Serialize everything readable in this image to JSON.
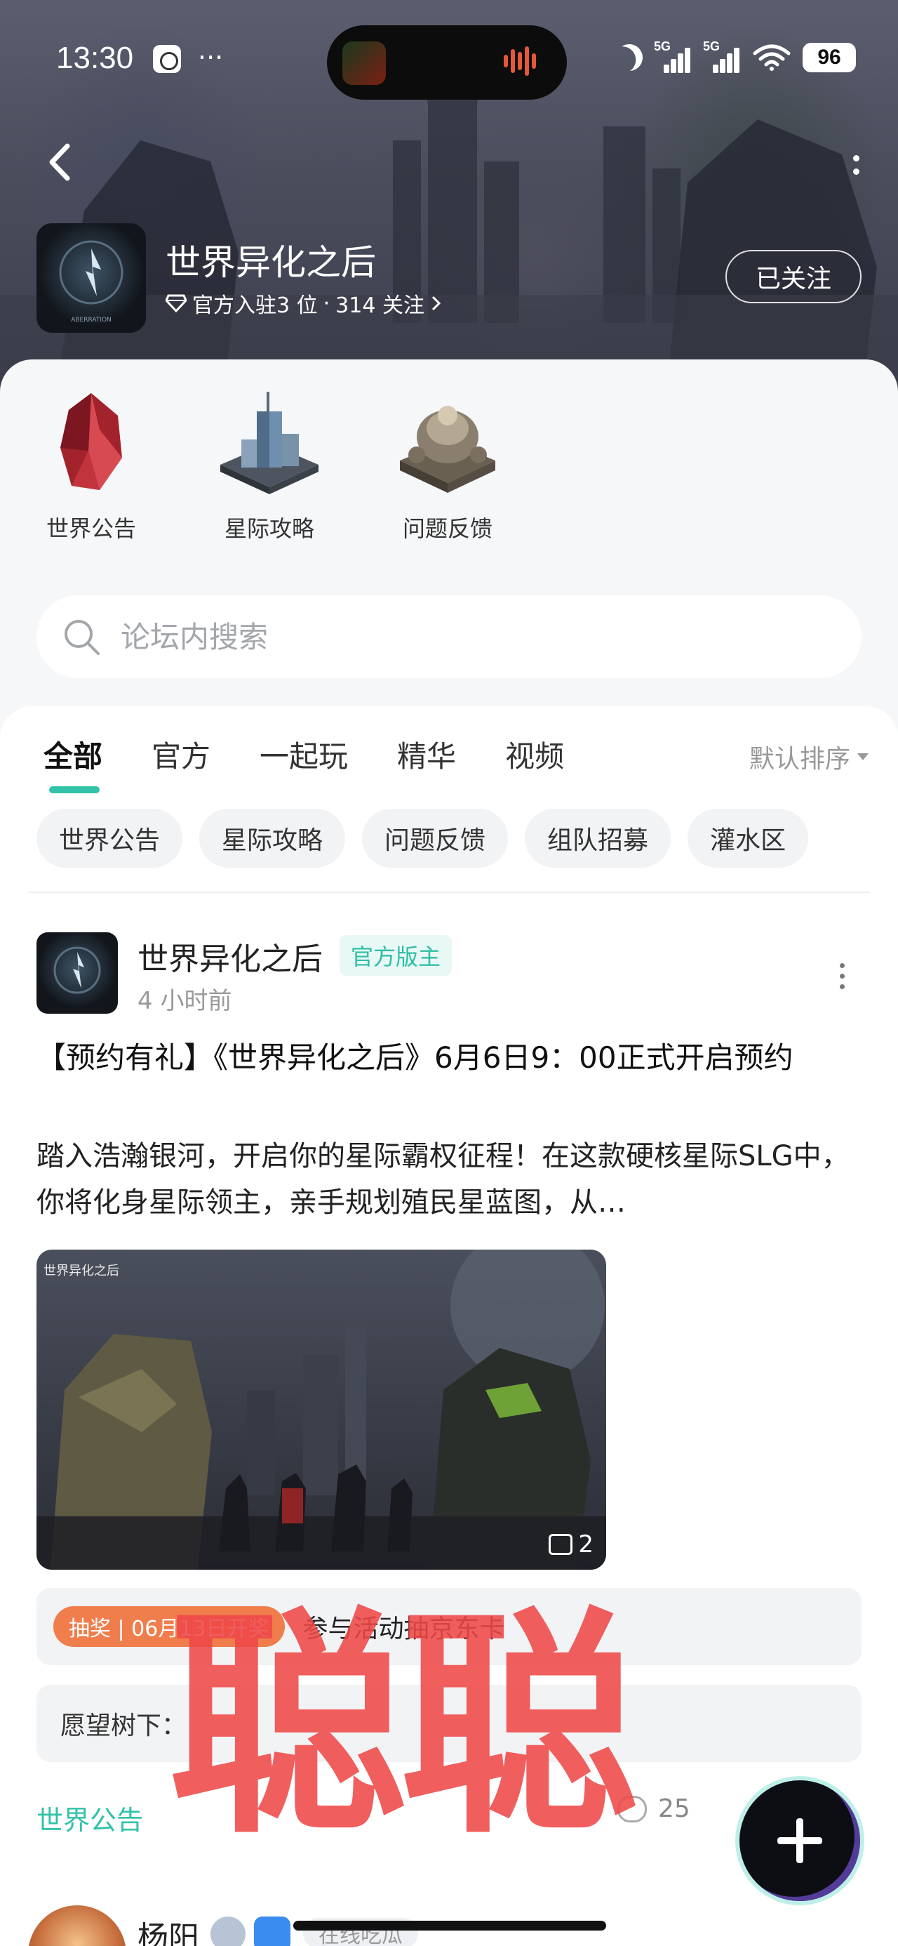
{
  "status_bar": {
    "time": "13:30",
    "dots": "···",
    "signal_1": "5G",
    "signal_2": "5G",
    "battery": "96"
  },
  "header": {
    "forum_name": "世界异化之后",
    "official_count": "官方入驻3 位",
    "separator": "·",
    "followers": "314 关注",
    "follow_button": "已关注",
    "avatar_logo_text": "ABERRATION"
  },
  "quick_links": [
    {
      "label": "世界公告",
      "icon": "crystal-icon"
    },
    {
      "label": "星际攻略",
      "icon": "tower-icon"
    },
    {
      "label": "问题反馈",
      "icon": "reactor-icon"
    }
  ],
  "search": {
    "placeholder": "论坛内搜索"
  },
  "tabs": [
    "全部",
    "官方",
    "一起玩",
    "精华",
    "视频"
  ],
  "sort_label": "默认排序",
  "chips": [
    "世界公告",
    "星际攻略",
    "问题反馈",
    "组队招募",
    "灌水区"
  ],
  "post": {
    "author": "世界异化之后",
    "badge": "官方版主",
    "time": "4 小时前",
    "title": "【预约有礼】《世界异化之后》6月6日9：00正式开启预约",
    "body": "踏入浩瀚银河，开启你的星际霸权征程！在这款硬核星际SLG中，你将化身星际领主，亲手规划殖民星蓝图，从…",
    "image_logo": "世界异化之后",
    "image_count": "2",
    "lottery_tag": "抽奖 | 06月13日开奖",
    "lottery_text": "参与活动抽京东卡",
    "wish_text": "愿望树下：",
    "category": "世界公告",
    "comments": "25"
  },
  "next_post": {
    "author": "杨阳",
    "status": "在线吃瓜"
  },
  "watermark": "聪聪",
  "colors": {
    "accent": "#31c2a8",
    "lottery": "#f07d4c",
    "watermark": "#ee4848"
  }
}
